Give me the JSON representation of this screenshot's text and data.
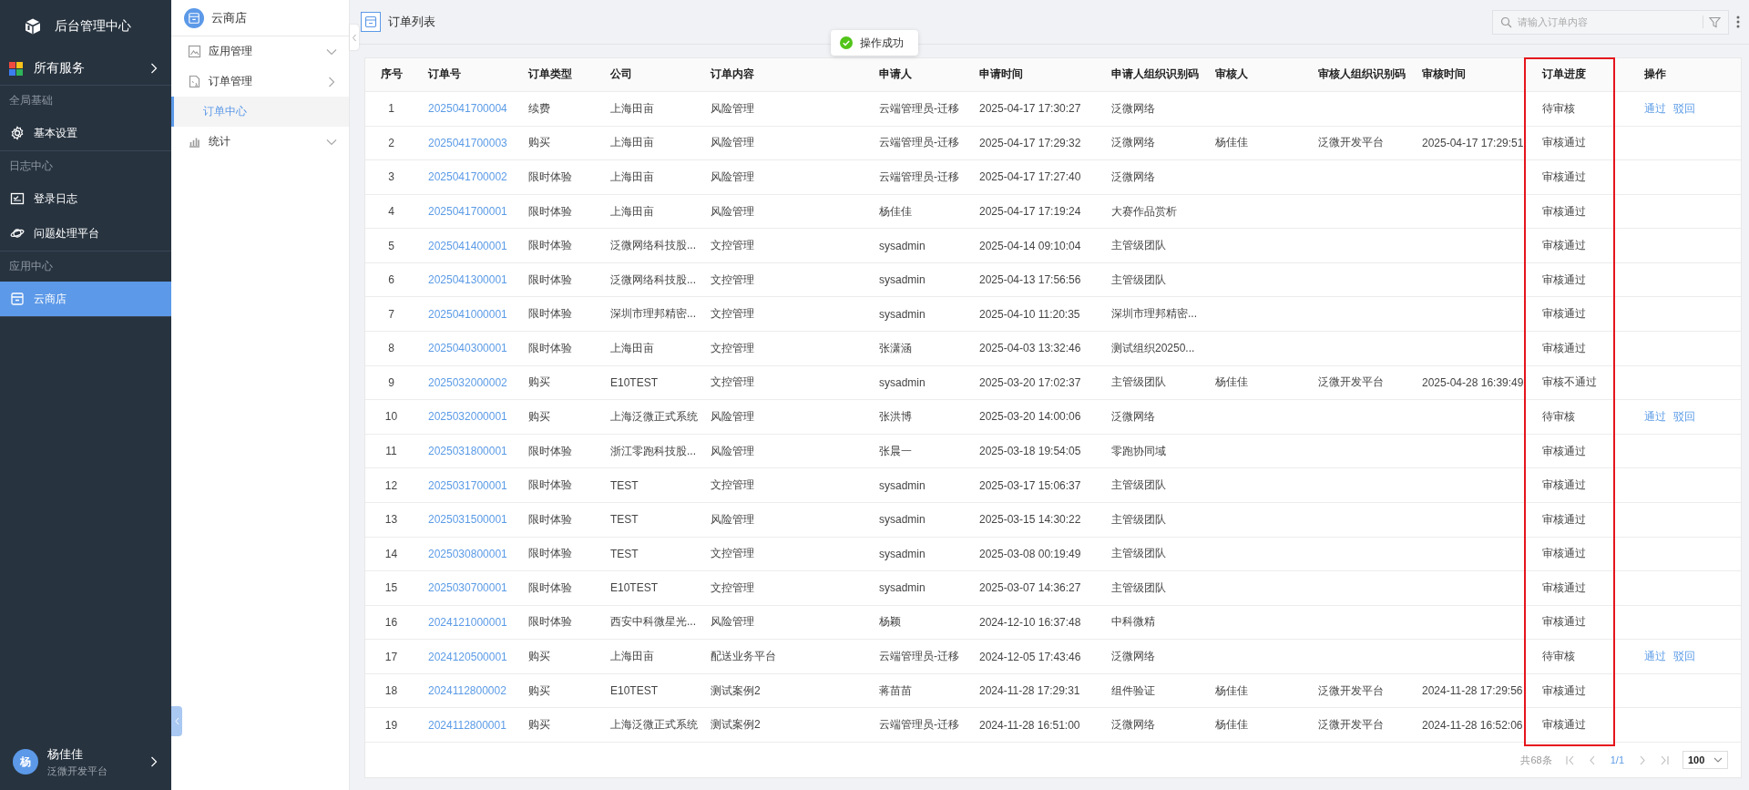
{
  "sidebar": {
    "logo_title": "后台管理中心",
    "all_services": "所有服务",
    "sections": [
      {
        "heading": "全局基础",
        "items": [
          {
            "label": "基本设置",
            "selected": false
          }
        ]
      },
      {
        "heading": "日志中心",
        "items": [
          {
            "label": "登录日志",
            "selected": false
          },
          {
            "label": "问题处理平台",
            "selected": false
          }
        ]
      },
      {
        "heading": "应用中心",
        "items": [
          {
            "label": "云商店",
            "selected": true
          }
        ]
      }
    ],
    "user": {
      "avatar": "杨",
      "name": "杨佳佳",
      "org": "泛微开发平台"
    }
  },
  "subnav": {
    "title": "云商店",
    "items": [
      {
        "label": "应用管理",
        "expanded": false
      },
      {
        "label": "订单管理",
        "expanded": true,
        "children": [
          {
            "label": "订单中心",
            "selected": true
          }
        ]
      },
      {
        "label": "统计",
        "expanded": false
      }
    ]
  },
  "header": {
    "title": "订单列表",
    "search": {
      "placeholder": "请输入订单内容"
    },
    "toast": "操作成功"
  },
  "table": {
    "columns": [
      {
        "label": "序号"
      },
      {
        "label": "订单号"
      },
      {
        "label": "订单类型"
      },
      {
        "label": "公司"
      },
      {
        "label": "订单内容"
      },
      {
        "label": "申请人"
      },
      {
        "label": "申请时间"
      },
      {
        "label": "申请人组织识别码"
      },
      {
        "label": "审核人"
      },
      {
        "label": "审核人组织识别码"
      },
      {
        "label": "审核时间"
      },
      {
        "label": "订单进度",
        "highlighted": true
      },
      {
        "label": "操作"
      }
    ],
    "rows": [
      {
        "seq": "1",
        "order_no": "2025041700004",
        "type": "续费",
        "company": "上海田亩",
        "content": "风险管理",
        "applicant": "云端管理员-迁移",
        "applied_at": "2025-04-17 17:30:27",
        "applicant_org": "泛微网络",
        "progress": "待审核",
        "actions": [
          "通过",
          "驳回"
        ]
      },
      {
        "seq": "2",
        "order_no": "2025041700003",
        "type": "购买",
        "company": "上海田亩",
        "content": "风险管理",
        "applicant": "云端管理员-迁移",
        "applied_at": "2025-04-17 17:29:32",
        "applicant_org": "泛微网络",
        "reviewer": "杨佳佳",
        "reviewer_org": "泛微开发平台",
        "reviewed_at": "2025-04-17 17:29:51",
        "progress": "审核通过"
      },
      {
        "seq": "3",
        "order_no": "2025041700002",
        "type": "限时体验",
        "company": "上海田亩",
        "content": "风险管理",
        "applicant": "云端管理员-迁移",
        "applied_at": "2025-04-17 17:27:40",
        "applicant_org": "泛微网络",
        "progress": "审核通过"
      },
      {
        "seq": "4",
        "order_no": "2025041700001",
        "type": "限时体验",
        "company": "上海田亩",
        "content": "风险管理",
        "applicant": "杨佳佳",
        "applied_at": "2025-04-17 17:19:24",
        "applicant_org": "大赛作品赏析",
        "progress": "审核通过"
      },
      {
        "seq": "5",
        "order_no": "2025041400001",
        "type": "限时体验",
        "company": "泛微网络科技股...",
        "content": "文控管理",
        "applicant": "sysadmin",
        "applied_at": "2025-04-14 09:10:04",
        "applicant_org": "主管级团队",
        "progress": "审核通过"
      },
      {
        "seq": "6",
        "order_no": "2025041300001",
        "type": "限时体验",
        "company": "泛微网络科技股...",
        "content": "文控管理",
        "applicant": "sysadmin",
        "applied_at": "2025-04-13 17:56:56",
        "applicant_org": "主管级团队",
        "progress": "审核通过"
      },
      {
        "seq": "7",
        "order_no": "2025041000001",
        "type": "限时体验",
        "company": "深圳市理邦精密...",
        "content": "文控管理",
        "applicant": "sysadmin",
        "applied_at": "2025-04-10 11:20:35",
        "applicant_org": "深圳市理邦精密...",
        "progress": "审核通过"
      },
      {
        "seq": "8",
        "order_no": "2025040300001",
        "type": "限时体验",
        "company": "上海田亩",
        "content": "文控管理",
        "applicant": "张潇涵",
        "applied_at": "2025-04-03 13:32:46",
        "applicant_org": "测试组织20250...",
        "progress": "审核通过"
      },
      {
        "seq": "9",
        "order_no": "2025032000002",
        "type": "购买",
        "company": "E10TEST",
        "content": "文控管理",
        "applicant": "sysadmin",
        "applied_at": "2025-03-20 17:02:37",
        "applicant_org": "主管级团队",
        "reviewer": "杨佳佳",
        "reviewer_org": "泛微开发平台",
        "reviewed_at": "2025-04-28 16:39:49",
        "progress": "审核不通过"
      },
      {
        "seq": "10",
        "order_no": "2025032000001",
        "type": "购买",
        "company": "上海泛微正式系统",
        "content": "风险管理",
        "applicant": "张洪博",
        "applied_at": "2025-03-20 14:00:06",
        "applicant_org": "泛微网络",
        "progress": "待审核",
        "actions": [
          "通过",
          "驳回"
        ]
      },
      {
        "seq": "11",
        "order_no": "2025031800001",
        "type": "限时体验",
        "company": "浙江零跑科技股...",
        "content": "风险管理",
        "applicant": "张晨一",
        "applied_at": "2025-03-18 19:54:05",
        "applicant_org": "零跑协同域",
        "progress": "审核通过"
      },
      {
        "seq": "12",
        "order_no": "2025031700001",
        "type": "限时体验",
        "company": "TEST",
        "content": "文控管理",
        "applicant": "sysadmin",
        "applied_at": "2025-03-17 15:06:37",
        "applicant_org": "主管级团队",
        "progress": "审核通过"
      },
      {
        "seq": "13",
        "order_no": "2025031500001",
        "type": "限时体验",
        "company": "TEST",
        "content": "风险管理",
        "applicant": "sysadmin",
        "applied_at": "2025-03-15 14:30:22",
        "applicant_org": "主管级团队",
        "progress": "审核通过"
      },
      {
        "seq": "14",
        "order_no": "2025030800001",
        "type": "限时体验",
        "company": "TEST",
        "content": "文控管理",
        "applicant": "sysadmin",
        "applied_at": "2025-03-08 00:19:49",
        "applicant_org": "主管级团队",
        "progress": "审核通过"
      },
      {
        "seq": "15",
        "order_no": "2025030700001",
        "type": "限时体验",
        "company": "E10TEST",
        "content": "文控管理",
        "applicant": "sysadmin",
        "applied_at": "2025-03-07 14:36:27",
        "applicant_org": "主管级团队",
        "progress": "审核通过"
      },
      {
        "seq": "16",
        "order_no": "2024121000001",
        "type": "限时体验",
        "company": "西安中科微星光...",
        "content": "风险管理",
        "applicant": "杨颖",
        "applied_at": "2024-12-10 16:37:48",
        "applicant_org": "中科微精",
        "progress": "审核通过"
      },
      {
        "seq": "17",
        "order_no": "2024120500001",
        "type": "购买",
        "company": "上海田亩",
        "content": "配送业务平台",
        "applicant": "云端管理员-迁移",
        "applied_at": "2024-12-05 17:43:46",
        "applicant_org": "泛微网络",
        "progress": "待审核",
        "actions": [
          "通过",
          "驳回"
        ]
      },
      {
        "seq": "18",
        "order_no": "2024112800002",
        "type": "购买",
        "company": "E10TEST",
        "content": "测试案例2",
        "applicant": "蒋苗苗",
        "applied_at": "2024-11-28 17:29:31",
        "applicant_org": "组件验证",
        "reviewer": "杨佳佳",
        "reviewer_org": "泛微开发平台",
        "reviewed_at": "2024-11-28 17:29:56",
        "progress": "审核通过"
      },
      {
        "seq": "19",
        "order_no": "2024112800001",
        "type": "购买",
        "company": "上海泛微正式系统",
        "content": "测试案例2",
        "applicant": "云端管理员-迁移",
        "applied_at": "2024-11-28 16:51:00",
        "applicant_org": "泛微网络",
        "reviewer": "杨佳佳",
        "reviewer_org": "泛微开发平台",
        "reviewed_at": "2024-11-28 16:52:06",
        "progress": "审核通过"
      }
    ]
  },
  "pagination": {
    "total": "共68条",
    "page": "1/1",
    "page_size": "100"
  }
}
